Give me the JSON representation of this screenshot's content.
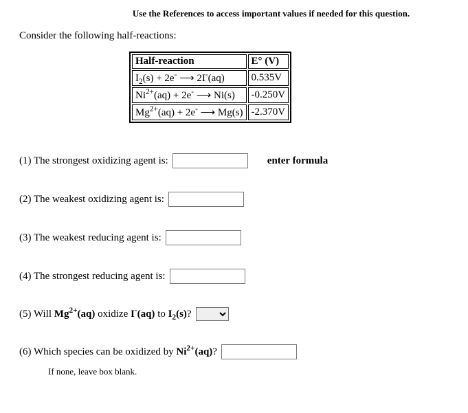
{
  "references": "Use the References to access important values if needed for this question.",
  "intro": "Consider the following half-reactions:",
  "table": {
    "h1": "Half-reaction",
    "h2": "E° (V)",
    "rows": [
      {
        "rxn_html": "I<sub>2</sub>(s) + 2e<sup>-</sup> <span class='arrow'>⟶</span> 2I<sup>-</sup>(aq)",
        "e": "0.535V"
      },
      {
        "rxn_html": "Ni<sup>2+</sup>(aq) + 2e<sup>-</sup> <span class='arrow'>⟶</span> Ni(s)",
        "e": "-0.250V"
      },
      {
        "rxn_html": "Mg<sup>2+</sup>(aq) + 2e<sup>-</sup> <span class='arrow'>⟶</span> Mg(s)",
        "e": "-2.370V"
      }
    ]
  },
  "q1": {
    "label": "(1) The strongest oxidizing agent is:",
    "hint": "enter formula"
  },
  "q2": {
    "label": "(2) The weakest oxidizing agent is:"
  },
  "q3": {
    "label": "(3) The weakest reducing agent is:"
  },
  "q4": {
    "label": "(4) The strongest reducing agent is:"
  },
  "q5": {
    "label_html": "(5) Will <b>Mg<sup>2+</sup>(aq)</b> oxidize <b>I<sup>-</sup>(aq)</b> to <b>I<sub>2</sub>(s)</b>?"
  },
  "q6": {
    "label_html": "(6) Which species can be oxidized by <b>Ni<sup>2+</sup>(aq)</b>?",
    "sub": "If none, leave box blank."
  }
}
